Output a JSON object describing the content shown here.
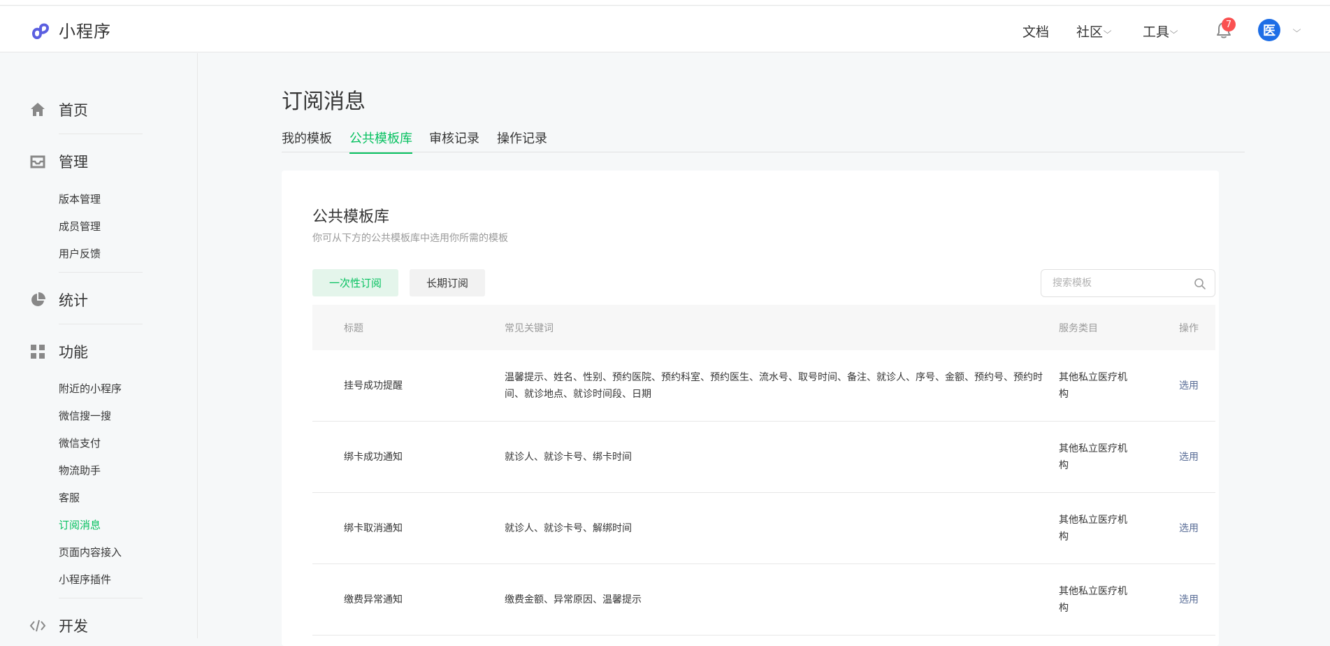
{
  "app": {
    "logo_text": "小程序"
  },
  "topnav": {
    "docs": "文档",
    "community": "社区",
    "tools": "工具",
    "notification_count": "7",
    "avatar_text": "医",
    "chevron": "⌵"
  },
  "sidebar": {
    "groups": [
      {
        "label": "首页",
        "icon": "home-icon"
      },
      {
        "label": "管理",
        "icon": "inbox-icon",
        "items": [
          "版本管理",
          "成员管理",
          "用户反馈"
        ]
      },
      {
        "label": "统计",
        "icon": "pie-chart-icon"
      },
      {
        "label": "功能",
        "icon": "grid-icon",
        "items": [
          "附近的小程序",
          "微信搜一搜",
          "微信支付",
          "物流助手",
          "客服",
          "订阅消息",
          "页面内容接入",
          "小程序插件"
        ]
      },
      {
        "label": "开发",
        "icon": "code-icon"
      }
    ],
    "active_item": "订阅消息"
  },
  "page": {
    "title": "订阅消息",
    "tabs": [
      "我的模板",
      "公共模板库",
      "审核记录",
      "操作记录"
    ],
    "active_tab": "公共模板库"
  },
  "card": {
    "title": "公共模板库",
    "desc": "你可从下方的公共模板库中选用你所需的模板",
    "type_buttons": [
      "一次性订阅",
      "长期订阅"
    ],
    "search_placeholder": "搜索模板"
  },
  "table": {
    "headers": [
      "标题",
      "常见关键词",
      "服务类目",
      "操作"
    ],
    "rows": [
      {
        "title": "挂号成功提醒",
        "keywords": "温馨提示、姓名、性别、预约医院、预约科室、预约医生、流水号、取号时间、备注、就诊人、序号、金额、预约号、预约时间、就诊地点、就诊时间段、日期",
        "category": "其他私立医疗机构",
        "action": "选用"
      },
      {
        "title": "绑卡成功通知",
        "keywords": "就诊人、就诊卡号、绑卡时间",
        "category": "其他私立医疗机构",
        "action": "选用"
      },
      {
        "title": "绑卡取消通知",
        "keywords": "就诊人、就诊卡号、解绑时间",
        "category": "其他私立医疗机构",
        "action": "选用"
      },
      {
        "title": "缴费异常通知",
        "keywords": "缴费金额、异常原因、温馨提示",
        "category": "其他私立医疗机构",
        "action": "选用"
      }
    ]
  },
  "colors": {
    "accent": "#07c160",
    "link": "#576b95",
    "badge": "#fa5151"
  }
}
